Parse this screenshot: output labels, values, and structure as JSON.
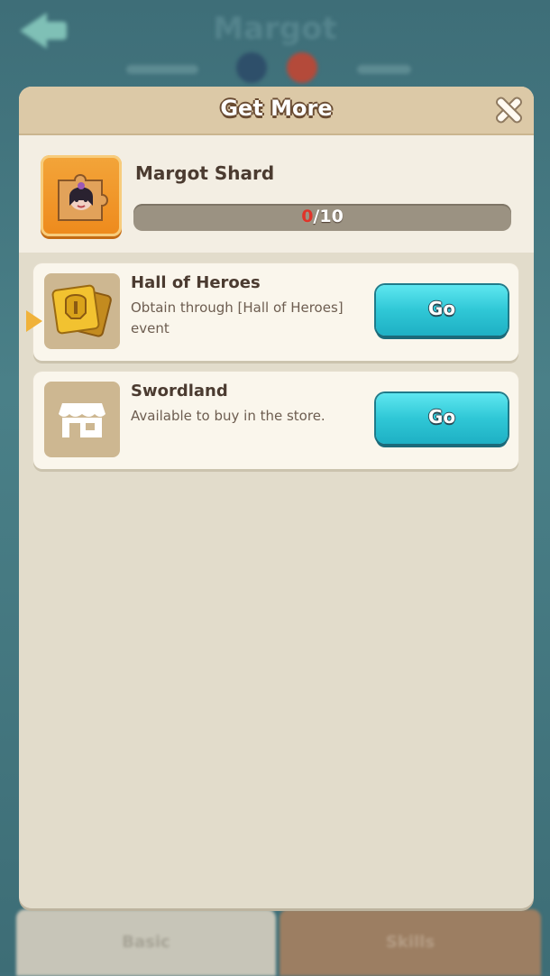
{
  "background": {
    "title": "Margot",
    "bottom_tabs": [
      "Basic",
      "Skills"
    ]
  },
  "modal": {
    "title": "Get More",
    "close_icon": "close-icon"
  },
  "item": {
    "name": "Margot Shard",
    "progress": {
      "current": "0",
      "separator_total": "/10",
      "fraction": 0
    },
    "icon": "hero-shard-icon"
  },
  "sources": [
    {
      "title": "Hall of Heroes",
      "description": "Obtain through [Hall of Heroes] event",
      "button_label": "Go",
      "icon": "helmet-tickets-icon"
    },
    {
      "title": "Swordland",
      "description": "Available to buy in the store.",
      "button_label": "Go",
      "icon": "store-icon"
    }
  ],
  "colors": {
    "accent_button": "#2fc7d6",
    "progress_current": "#e0342a",
    "header_bg": "#dcc9a7"
  }
}
